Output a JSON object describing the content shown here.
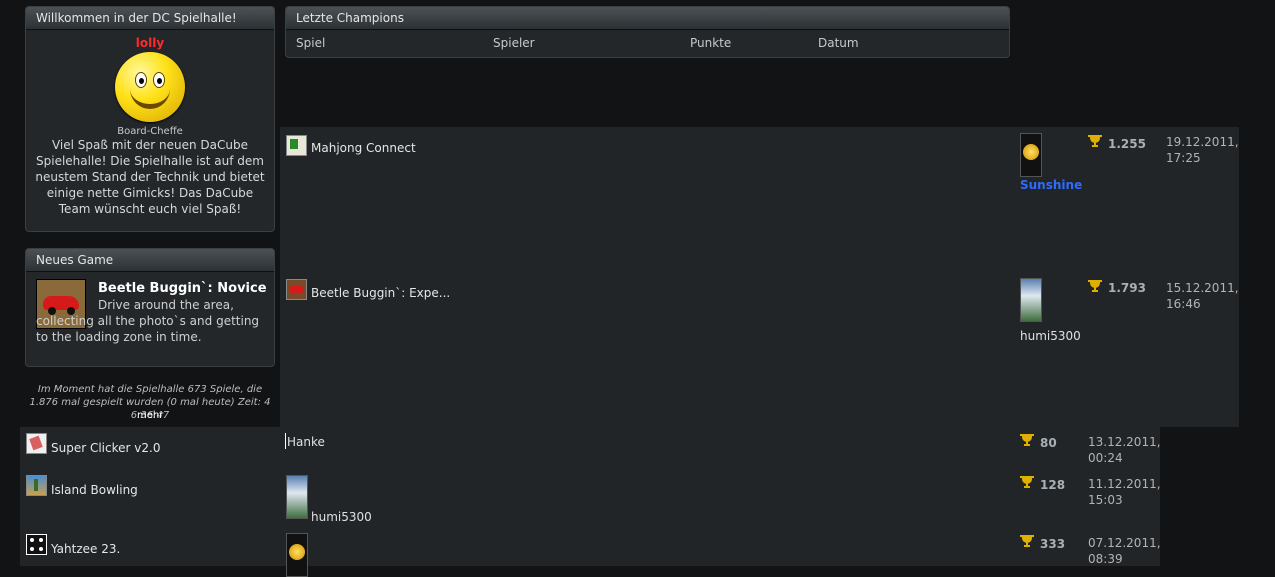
{
  "welcome": {
    "title": "Willkommen in der DC Spielhalle!",
    "username": "lolly",
    "rank": "Board-Cheffe",
    "text": "Viel Spaß mit der neuen DaCube Spielehalle! Die Spielhalle ist auf dem neustem Stand der Technik und bietet einige nette Gimicks! Das DaCube Team wünscht euch viel Spaß!"
  },
  "new_game": {
    "title": "Neues Game",
    "game_title": "Beetle Buggin`: Novice",
    "description": "Drive around the area, collecting all the photo`s and getting to the loading zone in time."
  },
  "stats": {
    "text": "Im Moment hat die Spielhalle 673 Spiele, die 1.876 mal gespielt wurden (0 mal heute) Zeit: 4 6:36:47",
    "more": "mehr"
  },
  "champions": {
    "title": "Letzte Champions",
    "columns": [
      "Spiel",
      "Spieler",
      "Punkte",
      "Datum"
    ],
    "rows": [
      {
        "game": "Mahjong Connect",
        "player": "Sunshine",
        "score": "1.255",
        "date_line1": "19.12.2011,",
        "date_line2": "17:25",
        "icon": "mahjong-icon",
        "avatar": "sun-avatar"
      },
      {
        "game": "Beetle Buggin`: Expe...",
        "player": "humi5300",
        "score": "1.793",
        "date_line1": "15.12.2011,",
        "date_line2": "16:46",
        "icon": "beetle-icon",
        "avatar": "robot-avatar"
      },
      {
        "game": "Super Clicker v2.0",
        "player": "Hanke",
        "score": "80",
        "date_line1": "13.12.2011,",
        "date_line2": "00:24",
        "icon": "clicker-icon",
        "avatar": ""
      },
      {
        "game": "Island Bowling",
        "player": "humi5300",
        "score": "128",
        "date_line1": "11.12.2011,",
        "date_line2": "15:03",
        "icon": "bowling-icon",
        "avatar": "robot-avatar"
      },
      {
        "game": "Yahtzee 23.",
        "player": "",
        "score": "333",
        "date_line1": "07.12.2011,",
        "date_line2": "08:39",
        "icon": "dice-icon",
        "avatar": "sun-avatar"
      }
    ]
  },
  "colors": {
    "username": "#ff2a2a",
    "player_highlight": "#2e6bff",
    "trophy": "#e0b000"
  }
}
